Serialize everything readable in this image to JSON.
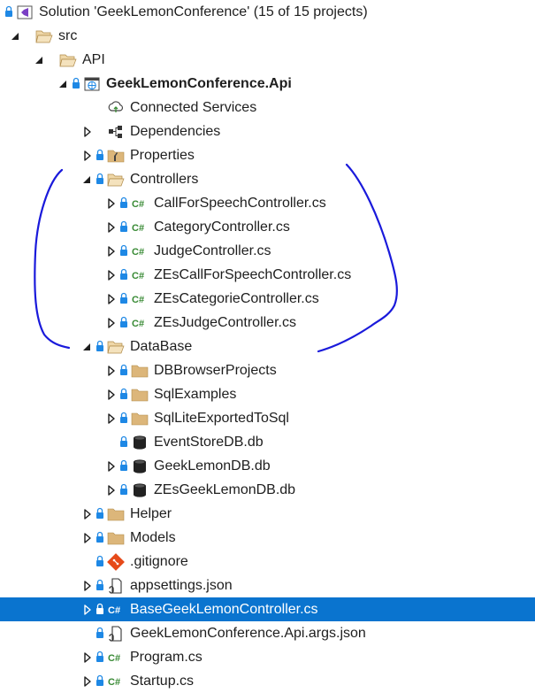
{
  "solution_explorer": {
    "nodes": [
      {
        "name": "solution-node",
        "label": "Solution 'GeekLemonConference' (15 of 15 projects)",
        "level": 0,
        "expander": "none",
        "locked": true,
        "icon": "solution-icon"
      },
      {
        "name": "folder-node-src",
        "label": "src",
        "level": 1,
        "expander": "expanded",
        "locked": false,
        "icon": "folder-open-icon"
      },
      {
        "name": "folder-node-api",
        "label": "API",
        "level": 2,
        "expander": "expanded",
        "locked": false,
        "icon": "folder-open-icon"
      },
      {
        "name": "project-node-api",
        "label": "GeekLemonConference.Api",
        "level": 3,
        "expander": "expanded",
        "locked": true,
        "icon": "web-project-icon",
        "bold": true
      },
      {
        "name": "connected-services-node",
        "label": "Connected Services",
        "level": 4,
        "expander": "none",
        "locked": false,
        "icon": "connected-services-icon"
      },
      {
        "name": "dependencies-node",
        "label": "Dependencies",
        "level": 4,
        "expander": "collapsed",
        "locked": false,
        "icon": "dependencies-icon"
      },
      {
        "name": "properties-node",
        "label": "Properties",
        "level": 4,
        "expander": "collapsed",
        "locked": true,
        "icon": "properties-folder-icon"
      },
      {
        "name": "folder-node-controllers",
        "label": "Controllers",
        "level": 4,
        "expander": "expanded",
        "locked": true,
        "icon": "folder-open-icon"
      },
      {
        "name": "file-node-callforspeechcontroller",
        "label": "CallForSpeechController.cs",
        "level": 5,
        "expander": "collapsed",
        "locked": true,
        "icon": "csharp-file-icon"
      },
      {
        "name": "file-node-categorycontroller",
        "label": "CategoryController.cs",
        "level": 5,
        "expander": "collapsed",
        "locked": true,
        "icon": "csharp-file-icon"
      },
      {
        "name": "file-node-judgecontroller",
        "label": "JudgeController.cs",
        "level": 5,
        "expander": "collapsed",
        "locked": true,
        "icon": "csharp-file-icon"
      },
      {
        "name": "file-node-zescallforspeechcontroller",
        "label": "ZEsCallForSpeechController.cs",
        "level": 5,
        "expander": "collapsed",
        "locked": true,
        "icon": "csharp-file-icon"
      },
      {
        "name": "file-node-zescategoriecontroller",
        "label": "ZEsCategorieController.cs",
        "level": 5,
        "expander": "collapsed",
        "locked": true,
        "icon": "csharp-file-icon"
      },
      {
        "name": "file-node-zesjudgecontroller",
        "label": "ZEsJudgeController.cs",
        "level": 5,
        "expander": "collapsed",
        "locked": true,
        "icon": "csharp-file-icon"
      },
      {
        "name": "folder-node-database",
        "label": "DataBase",
        "level": 4,
        "expander": "expanded",
        "locked": true,
        "icon": "folder-open-icon"
      },
      {
        "name": "folder-node-dbbrowserprojects",
        "label": "DBBrowserProjects",
        "level": 5,
        "expander": "collapsed",
        "locked": true,
        "icon": "folder-icon"
      },
      {
        "name": "folder-node-sqlexamples",
        "label": "SqlExamples",
        "level": 5,
        "expander": "collapsed",
        "locked": true,
        "icon": "folder-icon"
      },
      {
        "name": "folder-node-sqlliteexportedtosql",
        "label": "SqlLiteExportedToSql",
        "level": 5,
        "expander": "collapsed",
        "locked": true,
        "icon": "folder-icon"
      },
      {
        "name": "file-node-eventstoredb",
        "label": "EventStoreDB.db",
        "level": 5,
        "expander": "none",
        "locked": true,
        "icon": "database-icon"
      },
      {
        "name": "file-node-geeklemondb",
        "label": "GeekLemonDB.db",
        "level": 5,
        "expander": "collapsed",
        "locked": true,
        "icon": "database-icon"
      },
      {
        "name": "file-node-zesgeeklemondb",
        "label": "ZEsGeekLemonDB.db",
        "level": 5,
        "expander": "collapsed",
        "locked": true,
        "icon": "database-icon"
      },
      {
        "name": "folder-node-helper",
        "label": "Helper",
        "level": 4,
        "expander": "collapsed",
        "locked": true,
        "icon": "folder-icon"
      },
      {
        "name": "folder-node-models",
        "label": "Models",
        "level": 4,
        "expander": "collapsed",
        "locked": true,
        "icon": "folder-icon"
      },
      {
        "name": "file-node-gitignore",
        "label": ".gitignore",
        "level": 4,
        "expander": "none",
        "locked": true,
        "icon": "git-icon"
      },
      {
        "name": "file-node-appsettings",
        "label": "appsettings.json",
        "level": 4,
        "expander": "collapsed",
        "locked": true,
        "icon": "json-file-icon"
      },
      {
        "name": "file-node-basegeeklemoncontroller",
        "label": "BaseGeekLemonController.cs",
        "level": 4,
        "expander": "collapsed",
        "locked": true,
        "icon": "csharp-file-icon",
        "selected": true
      },
      {
        "name": "file-node-apiargs",
        "label": "GeekLemonConference.Api.args.json",
        "level": 4,
        "expander": "none",
        "locked": true,
        "icon": "json-file-icon"
      },
      {
        "name": "file-node-program",
        "label": "Program.cs",
        "level": 4,
        "expander": "collapsed",
        "locked": true,
        "icon": "csharp-file-icon"
      },
      {
        "name": "file-node-startup",
        "label": "Startup.cs",
        "level": 4,
        "expander": "collapsed",
        "locked": true,
        "icon": "csharp-file-icon"
      }
    ]
  },
  "colors": {
    "selection": "#0a74cf",
    "folder": "#dcb67a",
    "csharp": "#388a34",
    "lock": "#1e88e5",
    "annotation": "#1a1adb"
  }
}
